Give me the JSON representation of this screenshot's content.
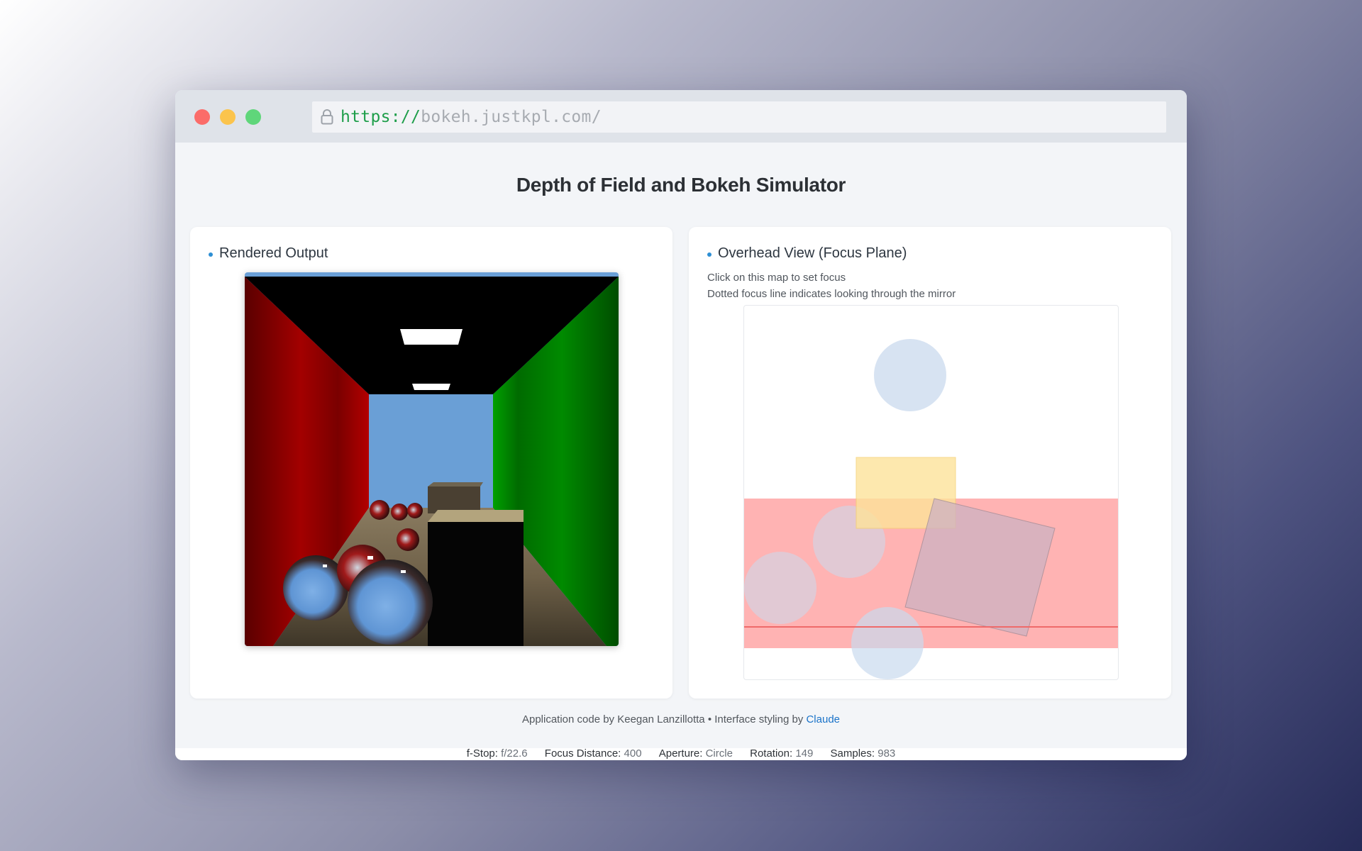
{
  "browser": {
    "url_scheme": "https://",
    "url_host": "bokeh.justkpl.com/"
  },
  "page": {
    "title": "Depth of Field and Bokeh Simulator"
  },
  "rendered_panel": {
    "title": "Rendered Output"
  },
  "overhead_panel": {
    "title": "Overhead View (Focus Plane)",
    "hint_1": "Click on this map to set focus",
    "hint_2": "Dotted focus line indicates looking through the mirror"
  },
  "footer": {
    "credit_prefix": "Application code by Keegan Lanzillotta • Interface styling by",
    "credit_link": "Claude"
  },
  "status": {
    "fstop_label": "f-Stop:",
    "fstop_value": "f/22.6",
    "focus_label": "Focus Distance:",
    "focus_value": "400",
    "aperture_label": "Aperture:",
    "aperture_value": "Circle",
    "rotation_label": "Rotation:",
    "rotation_value": "149",
    "samples_label": "Samples:",
    "samples_value": "983"
  },
  "colors": {
    "focus_band": "#ffb3b3",
    "focus_line": "#ef6a6a",
    "sphere": "#c9daee",
    "box_small": "#fde39a",
    "box_large": "#cdb2c2",
    "link": "#1a73c9"
  }
}
